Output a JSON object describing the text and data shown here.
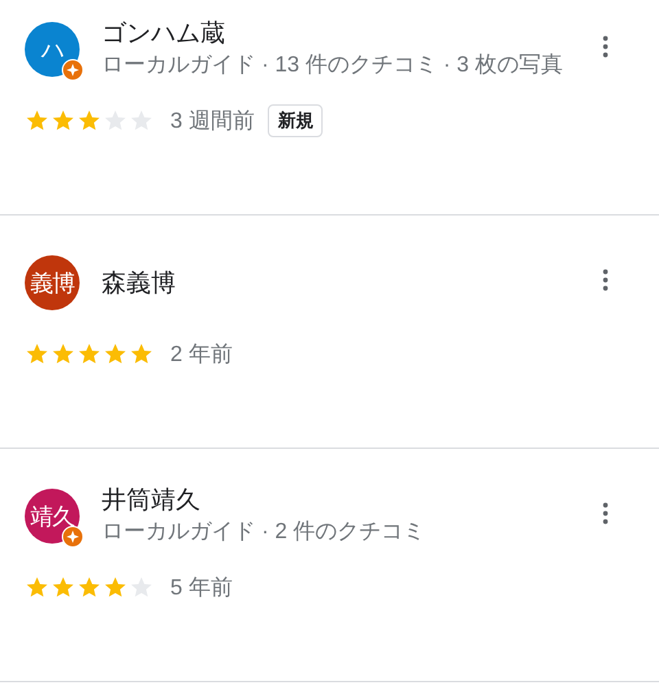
{
  "reviews": [
    {
      "avatar_text": "ハ",
      "color": "#0a84d0",
      "local_guide": true,
      "name": "ゴンハム蔵",
      "meta": "ローカルガイド · 13 件のクチコミ · 3 枚の写真",
      "stars": 3,
      "time": "3 週間前",
      "badge": "新規"
    },
    {
      "avatar_text": "義博",
      "color": "#c0360c",
      "local_guide": false,
      "name": "森義博",
      "stars": 5,
      "time": "2 年前"
    },
    {
      "avatar_text": "靖久",
      "color": "#c2185b",
      "local_guide": true,
      "name": "井筒靖久",
      "meta": "ローカルガイド · 2 件のクチコミ",
      "stars": 4,
      "time": "5 年前"
    }
  ]
}
